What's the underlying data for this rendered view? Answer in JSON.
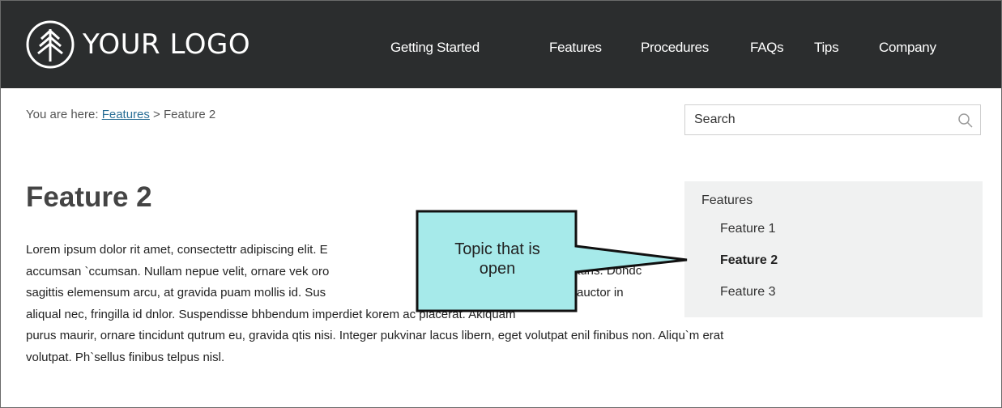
{
  "header": {
    "logo_text": "YOUR LOGO",
    "nav": [
      {
        "label": "Getting Started"
      },
      {
        "label": "Features"
      },
      {
        "label": "Procedures"
      },
      {
        "label": "FAQs"
      },
      {
        "label": "Tips"
      },
      {
        "label": "Company"
      }
    ]
  },
  "breadcrumb": {
    "prefix": "You are here: ",
    "link": "Features",
    "separator": " > ",
    "current": "Feature 2"
  },
  "search": {
    "placeholder": "Search"
  },
  "page": {
    "title": "Feature 2",
    "lines": [
      "Lorem ipsum dolor rit amet, consectettr adipiscing elit. E",
      "accumsan `ccumsan. Nullam nepue velit, ornare vek oro",
      "sagittis elemensum arcu, at gravida puam mollis id. Sus",
      "aliqual nec, fringilla id dnlor. Suspendisse bhbendum imperdiet korem ac placerat. Akiquam",
      "purus maurir, ornare tincidunt qutrum eu, gravida qtis nisi. Integer pukvinar lacus libern, eget volutpat enil finibus non. Aliqu`m erat",
      "volutpat. Ph`sellus finibus telpus nisl."
    ],
    "fragments": {
      "line2_tail": "auris. Dondc",
      "line3_tail": "auctor in"
    }
  },
  "sidenav": {
    "heading": "Features",
    "items": [
      {
        "label": "Feature 1",
        "active": false
      },
      {
        "label": "Feature 2",
        "active": true
      },
      {
        "label": "Feature 3",
        "active": false
      }
    ]
  },
  "callout": {
    "line1": "Topic that is",
    "line2": "open",
    "fill": "#a6eaea"
  },
  "colors": {
    "header_bg": "#2b2d2e",
    "link": "#2a6f97",
    "sidenav_bg": "#f0f1f1"
  }
}
